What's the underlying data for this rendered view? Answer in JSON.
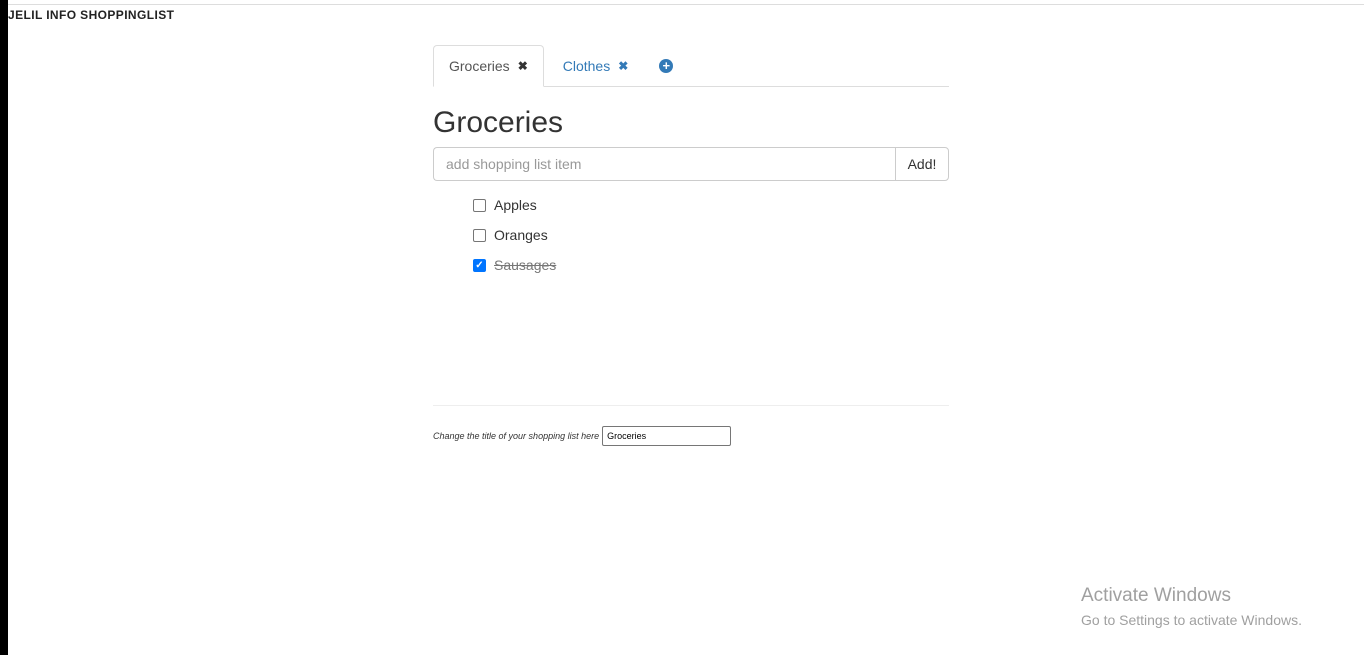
{
  "app": {
    "brand": "JELIL INFO SHOPPINGLIST"
  },
  "tabs": [
    {
      "label": "Groceries",
      "close": "✖",
      "active": true
    },
    {
      "label": "Clothes",
      "close": "✖",
      "active": false
    }
  ],
  "add_tab_icon": "plus-circle-icon",
  "list": {
    "title": "Groceries",
    "input_placeholder": "add shopping list item",
    "input_value": "",
    "add_button_label": "Add!",
    "items": [
      {
        "label": "Apples",
        "checked": false
      },
      {
        "label": "Oranges",
        "checked": false
      },
      {
        "label": "Sausages",
        "checked": true
      }
    ]
  },
  "rename": {
    "label": "Change the title of your shopping list here",
    "value": "Groceries"
  },
  "watermark": {
    "title": "Activate Windows",
    "subtitle": "Go to Settings to activate Windows."
  },
  "colors": {
    "link": "#337ab7",
    "checkbox_checked": "#0075ff"
  }
}
